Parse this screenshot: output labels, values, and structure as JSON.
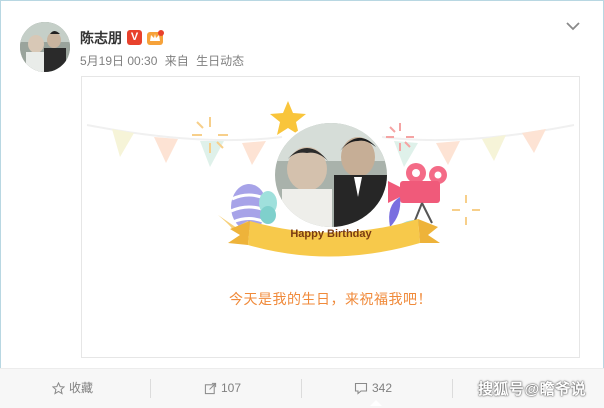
{
  "post": {
    "author": "陈志朋",
    "verified_badge": "V",
    "date": "5月19日 00:30",
    "source_prefix": "来自",
    "source": "生日动态"
  },
  "card": {
    "banner_text": "Happy Birthday",
    "message": "今天是我的生日，来祝福我吧！"
  },
  "actions": {
    "favorite_label": "收藏",
    "repost_count": "107",
    "comment_count": "342"
  },
  "watermark": "搜狐号@瞻爷说",
  "colors": {
    "message": "#f08a3a",
    "ribbon": "#f5c044",
    "badge": "#e8412c"
  }
}
